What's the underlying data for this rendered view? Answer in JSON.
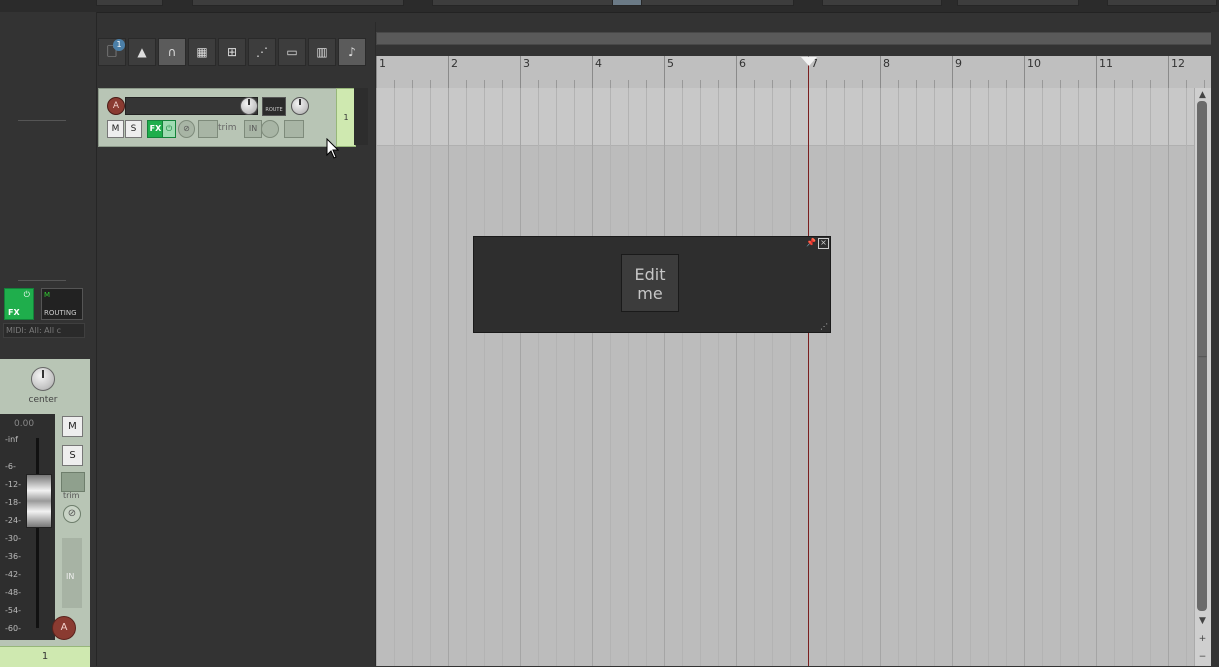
{
  "toolbar": {
    "badge": "1",
    "items": [
      {
        "name": "new-project-icon",
        "glyph": "🗋"
      },
      {
        "name": "metronome-icon",
        "glyph": "▲"
      },
      {
        "name": "snap-magnet-icon",
        "glyph": "∩"
      },
      {
        "name": "routing-matrix-icon",
        "glyph": "▦"
      },
      {
        "name": "grid-icon",
        "glyph": "⊞"
      },
      {
        "name": "envelope-icon",
        "glyph": "⋰"
      },
      {
        "name": "performance-meter-icon",
        "glyph": "▭"
      },
      {
        "name": "film-strip-icon",
        "glyph": "▥"
      },
      {
        "name": "lock-icon",
        "glyph": "♪"
      }
    ]
  },
  "tcp": {
    "arm_label": "A",
    "route_label": "ROUTE",
    "mute_label": "M",
    "solo_label": "S",
    "fx_label": "FX",
    "fx_power": "⏻",
    "phase": "⊘",
    "trim_label": "trim",
    "in_label": "IN",
    "track_number": "1"
  },
  "mixer": {
    "fx_label": "FX",
    "fx_power": "⏻",
    "route_label": "ROUTING",
    "route_ms": "M",
    "midi_input": "MIDI: All: All c",
    "pan_label": "center",
    "volume": "0.00",
    "scale": [
      "-inf",
      "-6-",
      "-12-",
      "-18-",
      "-24-",
      "-30-",
      "-36-",
      "-42-",
      "-48-",
      "-54-",
      "-60-"
    ],
    "mute_label": "M",
    "solo_label": "S",
    "trim_label": "trim",
    "phase": "⊘",
    "in_label": "IN",
    "arm_label": "A",
    "track_number": "1"
  },
  "ruler": {
    "labels": [
      "1",
      "2",
      "3",
      "4",
      "5",
      "6",
      "7",
      "8",
      "9",
      "10",
      "11",
      "12"
    ]
  },
  "float_window": {
    "button_line1": "Edit",
    "button_line2": "me",
    "pin": "📌",
    "close": "×",
    "grip": "⋰"
  },
  "colors": {
    "fx_green": "#1fae4c",
    "track_strip": "#b8c5b5",
    "track_number_bg": "#cfe9b0",
    "playhead": "#7a1f1f",
    "record_arm": "#8a3b31"
  }
}
